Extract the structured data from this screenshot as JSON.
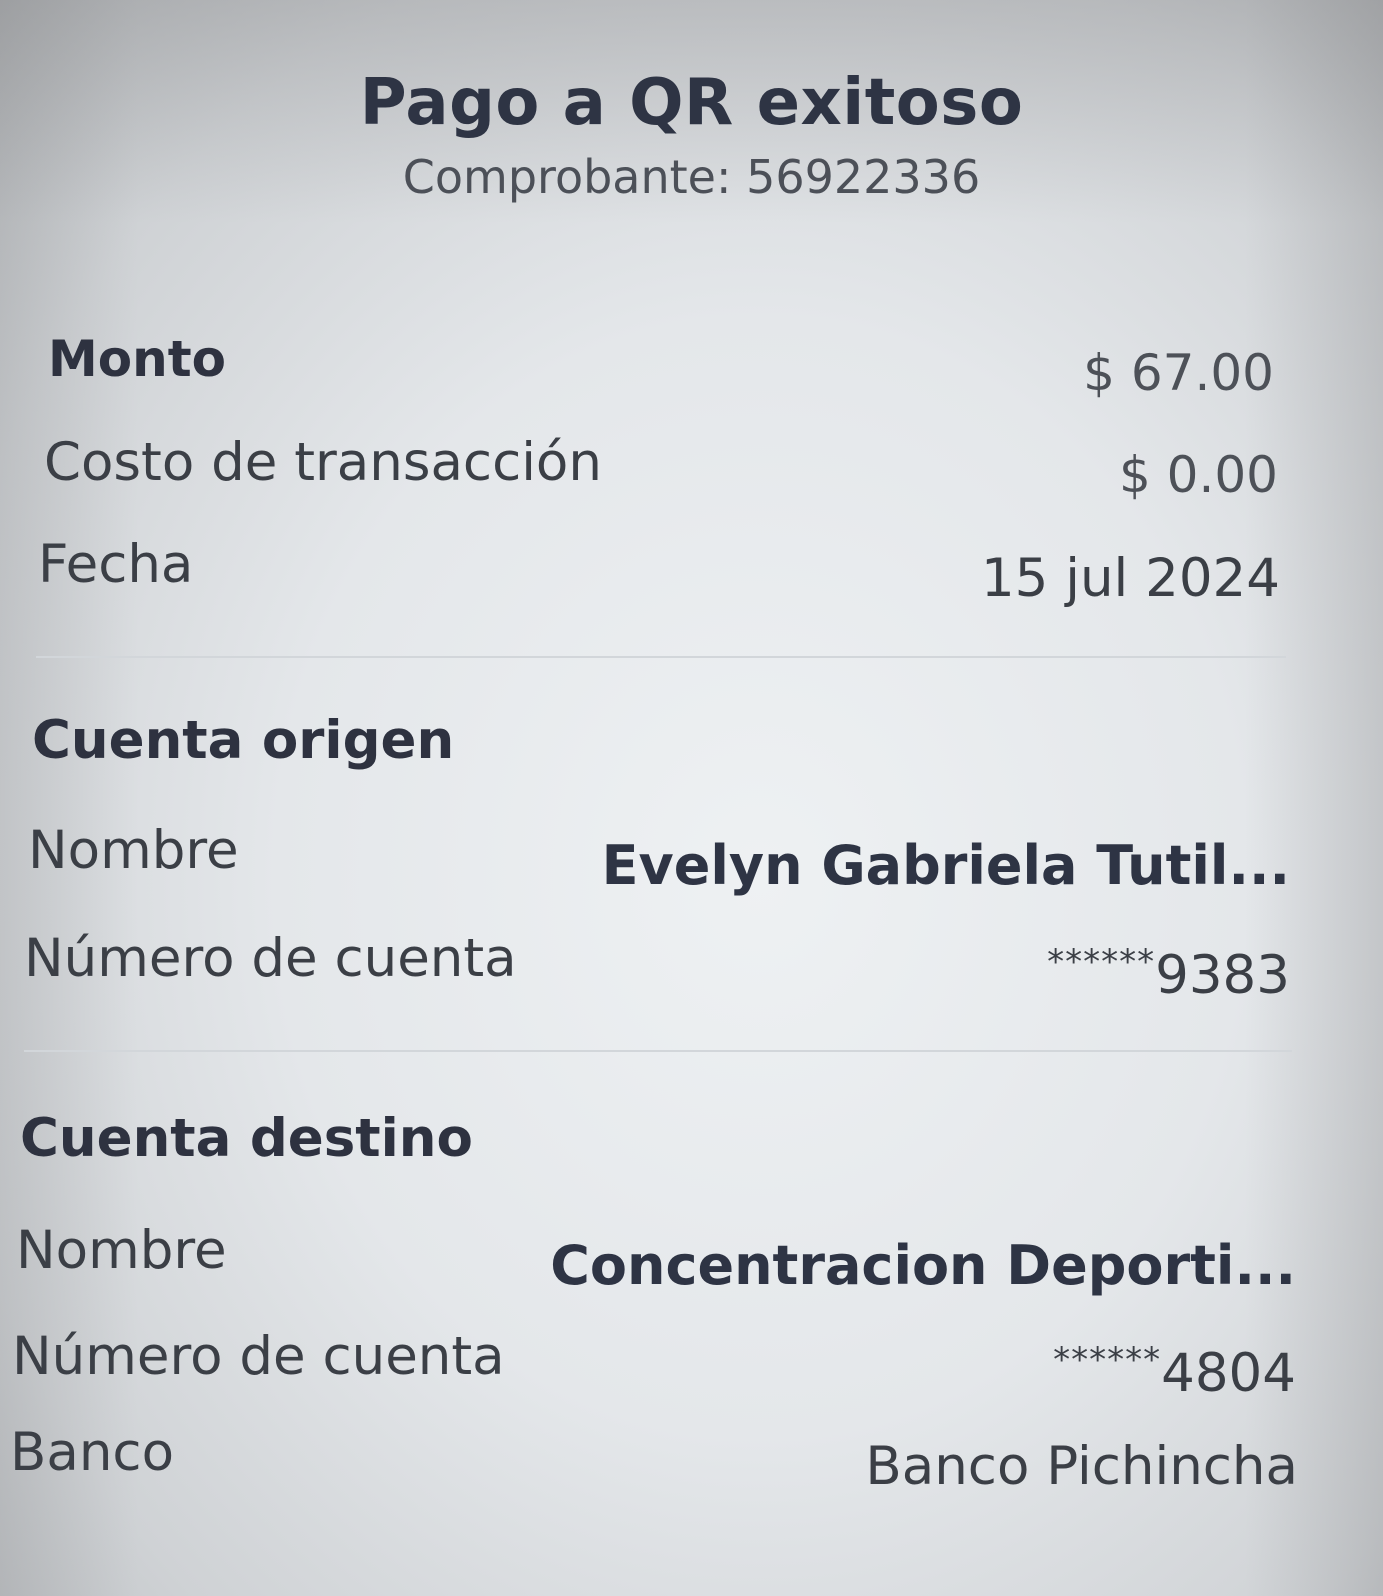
{
  "header": {
    "title": "Pago a QR exitoso",
    "subtitle": "Comprobante: 56922336"
  },
  "summary": {
    "monto": {
      "label": "Monto",
      "value": "$ 67.00"
    },
    "costo": {
      "label": "Costo de transacción",
      "value": "$ 0.00"
    },
    "fecha": {
      "label": "Fecha",
      "value": "15 jul 2024"
    }
  },
  "origen": {
    "title": "Cuenta origen",
    "nombre": {
      "label": "Nombre",
      "value": "Evelyn Gabriela Tutil..."
    },
    "cuenta": {
      "label": "Número de cuenta",
      "mask": "******",
      "digits": "9383"
    }
  },
  "destino": {
    "title": "Cuenta destino",
    "nombre": {
      "label": "Nombre",
      "value": "Concentracion Deporti..."
    },
    "cuenta": {
      "label": "Número de cuenta",
      "mask": "******",
      "digits": "4804"
    },
    "banco": {
      "label": "Banco",
      "value": "Banco Pichincha"
    }
  }
}
